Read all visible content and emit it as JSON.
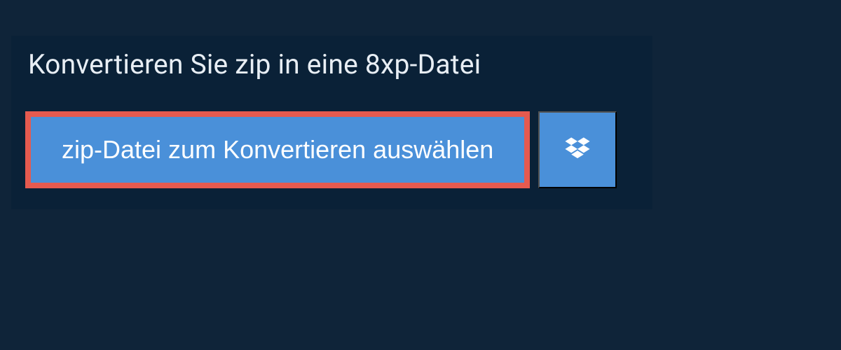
{
  "title": "Konvertieren Sie zip in eine 8xp-Datei",
  "select_button_label": "zip-Datei zum Konvertieren auswählen",
  "icons": {
    "dropbox": "dropbox-icon"
  },
  "colors": {
    "background": "#0f2439",
    "panel": "#0a2137",
    "button": "#4a90d9",
    "highlight_border": "#e55a4f",
    "text_light": "#e8eef4"
  }
}
